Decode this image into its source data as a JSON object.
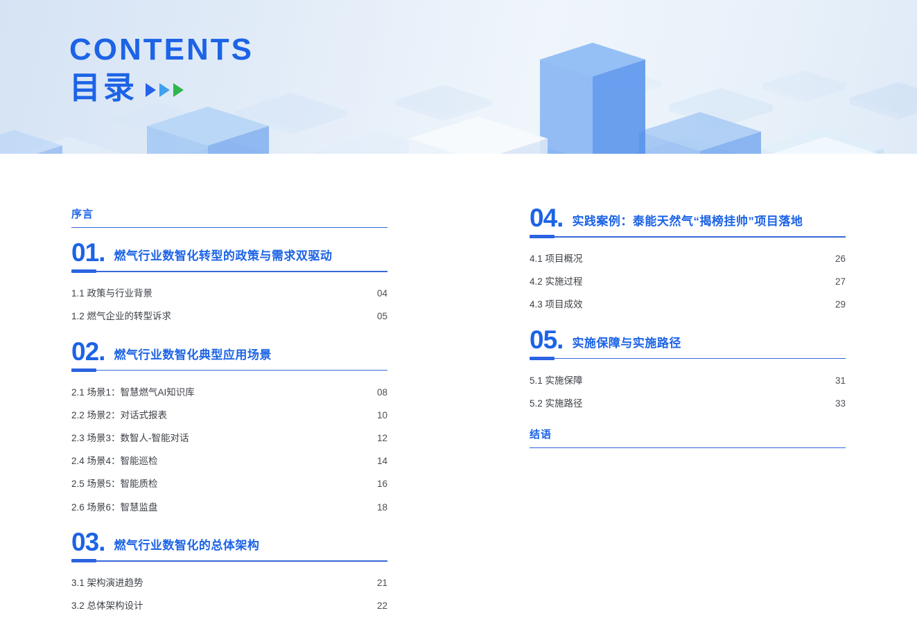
{
  "banner": {
    "title_en": "CONTENTS",
    "title_zh": "目录",
    "arrow_icon_colors": [
      "#2563eb",
      "#3fa0ec",
      "#2fb64e"
    ]
  },
  "style": {
    "accent_blue": "#1c63e6",
    "rule_blue": "#3767d8",
    "entry_text_color": "#3d4147",
    "banner_bg": "#e2ecf8"
  },
  "toc": {
    "left": [
      {
        "type": "plain",
        "label": "序言"
      },
      {
        "type": "section",
        "number": "01.",
        "title": "燃气行业数智化转型的政策与需求双驱动",
        "entries": [
          {
            "label": "1.1 政策与行业背景",
            "page": "04"
          },
          {
            "label": "1.2 燃气企业的转型诉求",
            "page": "05"
          }
        ]
      },
      {
        "type": "section",
        "number": "02.",
        "title": "燃气行业数智化典型应用场景",
        "entries": [
          {
            "label": "2.1 场景1：智慧燃气AI知识库",
            "page": "08"
          },
          {
            "label": "2.2 场景2：对话式报表",
            "page": "10"
          },
          {
            "label": "2.3 场景3：数智人-智能对话",
            "page": "12"
          },
          {
            "label": "2.4 场景4：智能巡检",
            "page": "14"
          },
          {
            "label": "2.5 场景5：智能质检",
            "page": "16"
          },
          {
            "label": "2.6 场景6：智慧监盘",
            "page": "18"
          }
        ]
      },
      {
        "type": "section",
        "number": "03.",
        "title": "燃气行业数智化的总体架构",
        "entries": [
          {
            "label": "3.1 架构演进趋势",
            "page": "21"
          },
          {
            "label": "3.2 总体架构设计",
            "page": "22"
          }
        ]
      }
    ],
    "right": [
      {
        "type": "section",
        "number": "04.",
        "title": "实践案例：泰能天然气“揭榜挂帅”项目落地",
        "entries": [
          {
            "label": "4.1 项目概况",
            "page": "26"
          },
          {
            "label": "4.2 实施过程",
            "page": "27"
          },
          {
            "label": "4.3 项目成效",
            "page": "29"
          }
        ]
      },
      {
        "type": "section",
        "number": "05.",
        "title": "实施保障与实施路径",
        "entries": [
          {
            "label": "5.1 实施保障",
            "page": "31"
          },
          {
            "label": "5.2 实施路径",
            "page": "33"
          }
        ]
      },
      {
        "type": "plain",
        "label": "结语"
      }
    ]
  }
}
